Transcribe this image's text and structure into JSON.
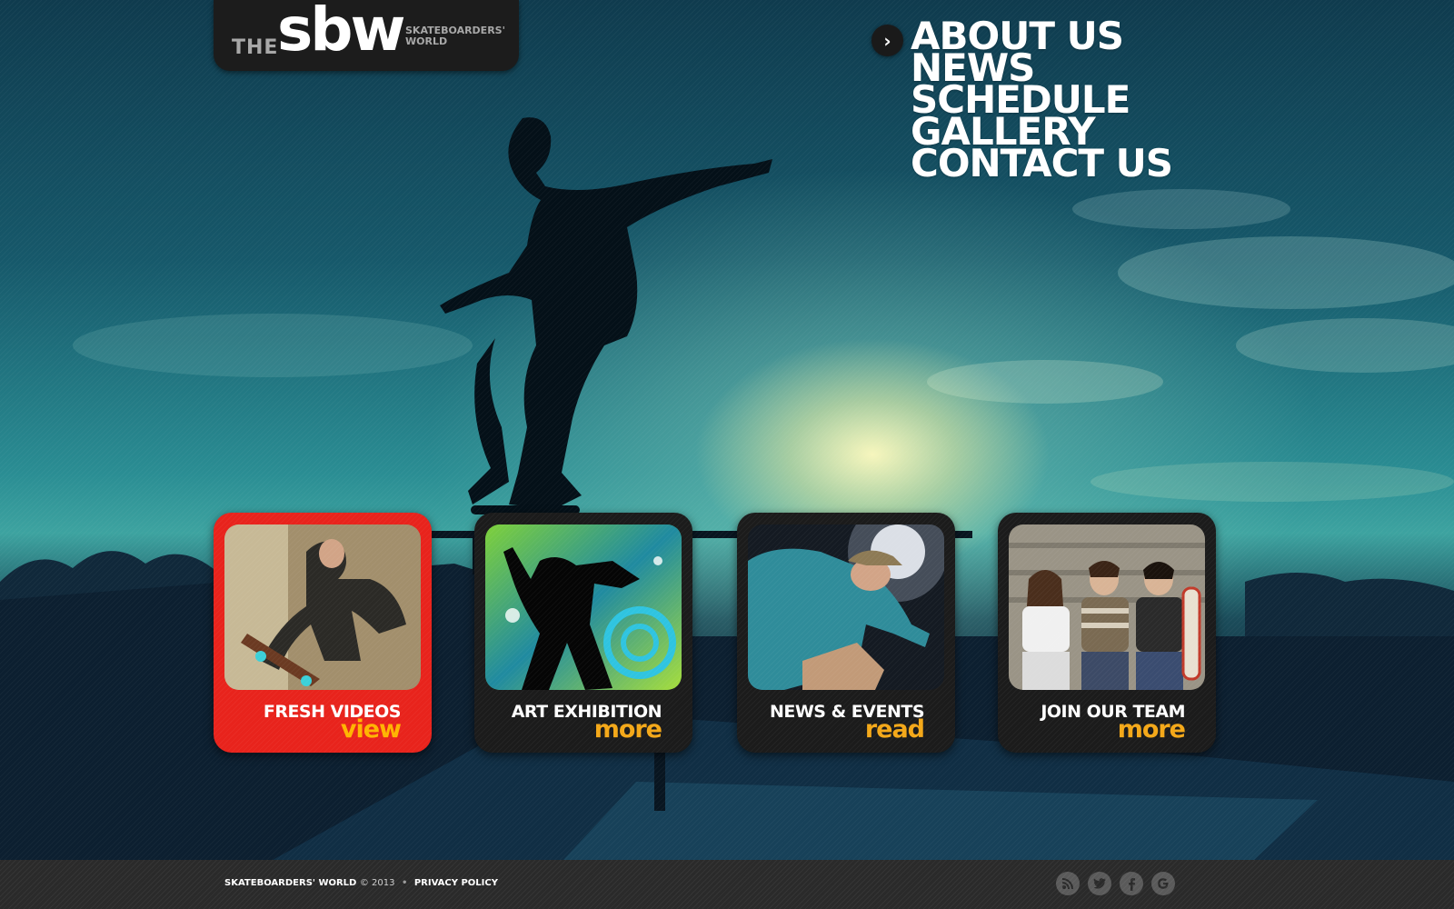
{
  "logo": {
    "the": "THE",
    "sbw": "sbw",
    "tag_line1": "SKATEBOARDERS'",
    "tag_line2": "WORLD"
  },
  "nav": {
    "items": [
      "ABOUT US",
      "NEWS",
      "SCHEDULE",
      "GALLERY",
      "CONTACT US"
    ]
  },
  "cards": [
    {
      "title": "FRESH VIDEOS",
      "link": "view",
      "active": true
    },
    {
      "title": "ART EXHIBITION",
      "link": "more",
      "active": false
    },
    {
      "title": "NEWS & EVENTS",
      "link": "read",
      "active": false
    },
    {
      "title": "JOIN OUR TEAM",
      "link": "more",
      "active": false
    }
  ],
  "footer": {
    "brand": "SKATEBOARDERS' WORLD",
    "year": "© 2013",
    "separator": "•",
    "privacy": "PRIVACY POLICY",
    "social_icons": [
      "rss-icon",
      "twitter-icon",
      "facebook-icon",
      "google-icon"
    ]
  },
  "colors": {
    "accent_red": "#e8231c",
    "link_orange": "#f4a818",
    "card_dark": "#1b1b1b",
    "footer": "#2a2a2a"
  }
}
